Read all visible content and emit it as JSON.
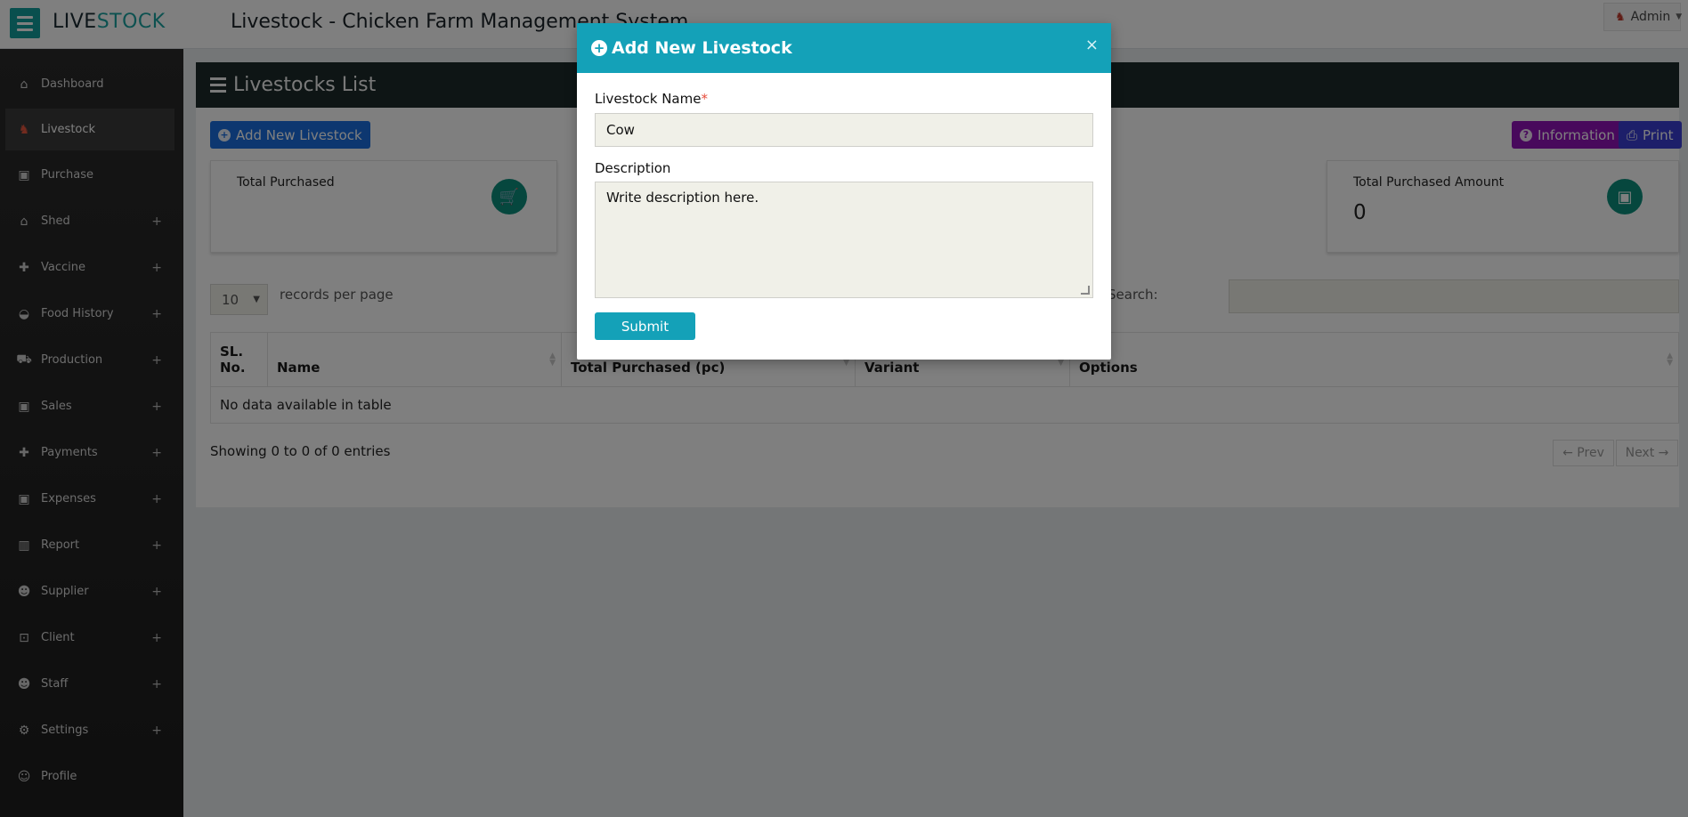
{
  "header": {
    "brand_part1": "LIVE",
    "brand_part2": "STOCK",
    "app_title": "Livestock - Chicken Farm Management System",
    "user_label": "Admin"
  },
  "sidebar": {
    "items": [
      {
        "label": "Dashboard",
        "icon": "home-icon",
        "expandable": false
      },
      {
        "label": "Livestock",
        "icon": "livestock-icon",
        "expandable": false,
        "active": true
      },
      {
        "label": "Purchase",
        "icon": "money-icon",
        "expandable": false
      },
      {
        "label": "Shed",
        "icon": "home-icon",
        "expandable": true
      },
      {
        "label": "Vaccine",
        "icon": "medkit-icon",
        "expandable": true
      },
      {
        "label": "Food History",
        "icon": "bowl-icon",
        "expandable": true
      },
      {
        "label": "Production",
        "icon": "cart-icon",
        "expandable": true
      },
      {
        "label": "Sales",
        "icon": "money-icon",
        "expandable": true
      },
      {
        "label": "Payments",
        "icon": "medkit-icon",
        "expandable": true
      },
      {
        "label": "Expenses",
        "icon": "money-icon",
        "expandable": true
      },
      {
        "label": "Report",
        "icon": "chart-icon",
        "expandable": true
      },
      {
        "label": "Supplier",
        "icon": "users-icon",
        "expandable": true
      },
      {
        "label": "Client",
        "icon": "client-icon",
        "expandable": true
      },
      {
        "label": "Staff",
        "icon": "staff-icon",
        "expandable": true
      },
      {
        "label": "Settings",
        "icon": "gears-icon",
        "expandable": true
      },
      {
        "label": "Profile",
        "icon": "user-icon",
        "expandable": false
      }
    ],
    "plus_glyph": "+"
  },
  "panel": {
    "title": "Livestocks List",
    "add_button": "Add New Livestock",
    "info_button": "Information",
    "print_button": "Print",
    "cards": [
      {
        "label": "Total Purchased",
        "value": ""
      },
      {
        "label": "Total Purchased Amount",
        "value": "0"
      }
    ],
    "page_length": "10",
    "records_label": "records per page",
    "search_label": "Search:",
    "table": {
      "columns": [
        "SL. No.",
        "Name",
        "Total Purchased (pc)",
        "Variant",
        "Options"
      ],
      "empty_message": "No data available in table"
    },
    "showing_text": "Showing 0 to 0 of 0 entries",
    "prev_label": "← Prev",
    "next_label": "Next →"
  },
  "modal": {
    "title": "Add New Livestock",
    "close_glyph": "×",
    "name_label": "Livestock Name",
    "required_mark": "*",
    "name_value": "Cow",
    "description_label": "Description",
    "description_value": "Write description here.",
    "submit_label": "Submit"
  },
  "colors": {
    "accent": "#14a1b8",
    "brand": "#1aa3a0",
    "add_button": "#1b6fe0",
    "info_button": "#9112b8",
    "print_button": "#3b3fd4",
    "card_icon": "#0d8f7c",
    "panel_header": "#1d2b2a",
    "sidebar": "#222222"
  }
}
